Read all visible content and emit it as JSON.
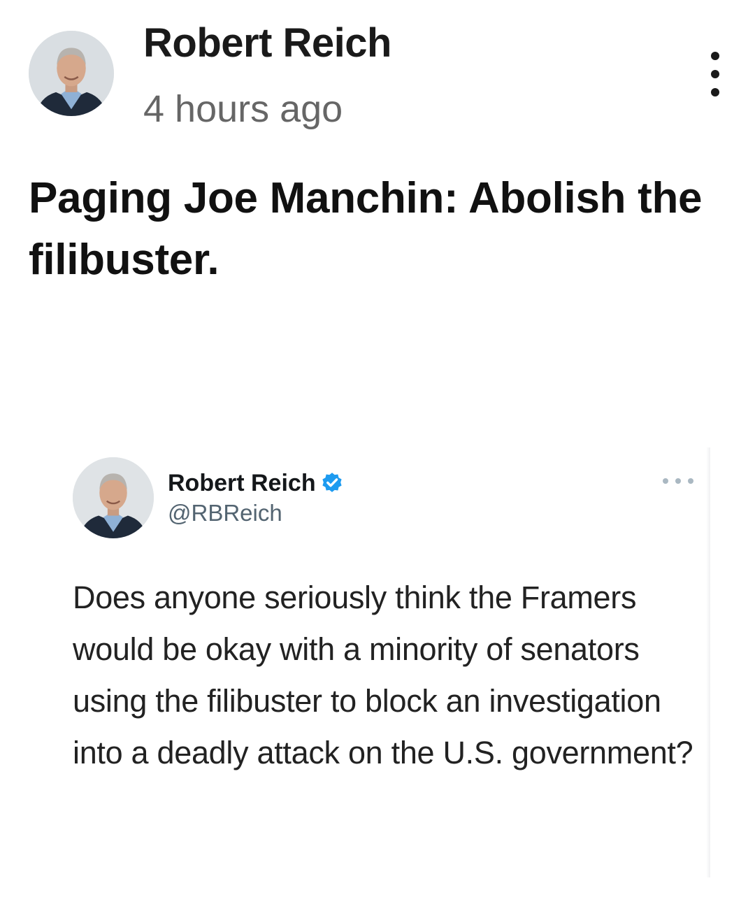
{
  "post": {
    "author": "Robert Reich",
    "timestamp": "4 hours ago",
    "menu_icon": "vertical-ellipsis-icon",
    "title": "Paging Joe Manchin: Abolish the filibuster."
  },
  "tweet": {
    "name": "Robert Reich",
    "handle": "@RBReich",
    "verified_icon": "verified-badge-icon",
    "verified_color": "#1d9bf0",
    "more_icon": "horizontal-ellipsis-icon",
    "text": "Does anyone seriously think the Framers would be okay with a minority of senators using the filibuster to block an investigation into a deadly attack on the U.S. government?"
  }
}
